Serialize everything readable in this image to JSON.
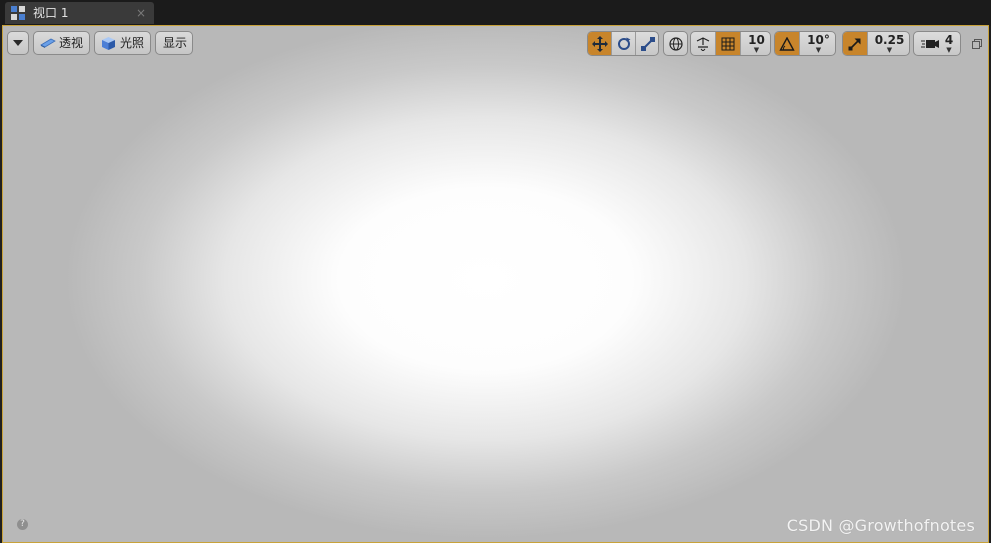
{
  "tab": {
    "title": "视口 1",
    "close": "×",
    "icon": "viewport-layout-icon"
  },
  "toolbar": {
    "menu_icon": "chevron-down-icon",
    "perspective_label": "透视",
    "lighting_label": "光照",
    "show_label": "显示",
    "transform_mode": "translate",
    "grid_snap_value": "10",
    "rotation_snap_value": "10°",
    "scale_snap_value": "0.25",
    "camera_speed_value": "4",
    "accent_color": "#c8852b",
    "restore_icon": "restore-window-icon"
  },
  "footer": {
    "help": "?",
    "watermark": "CSDN @Growthofnotes"
  }
}
